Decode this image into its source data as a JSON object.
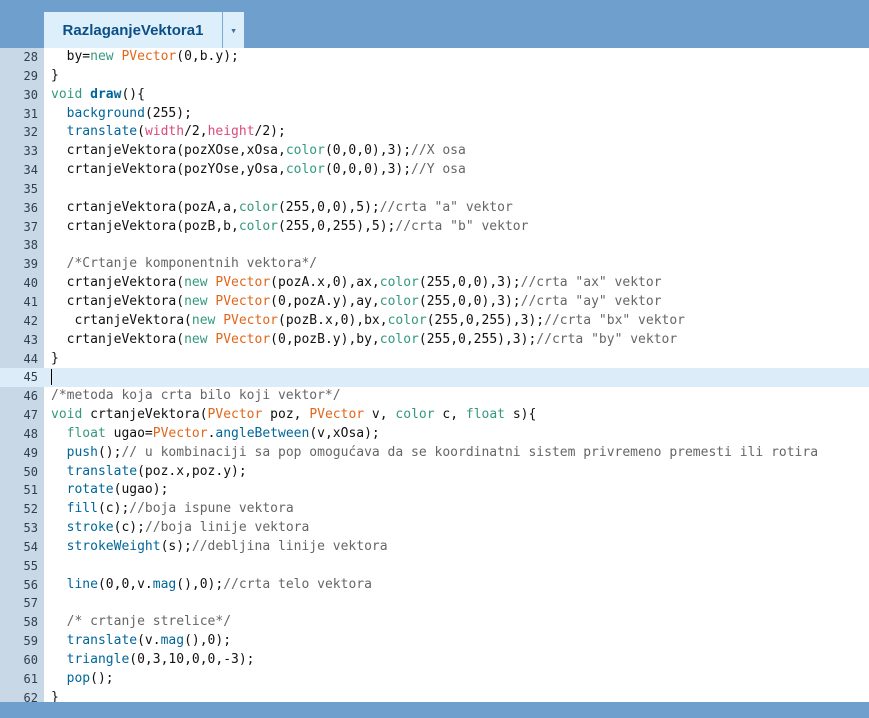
{
  "tab": {
    "title": "RazlaganjeVektora1",
    "menu_glyph": "▾"
  },
  "lines": [
    {
      "n": "28",
      "t": "  by=new PVector(0,b.y);"
    },
    {
      "n": "29",
      "t": "}"
    },
    {
      "n": "30",
      "t": "void draw(){"
    },
    {
      "n": "31",
      "t": "  background(255);"
    },
    {
      "n": "32",
      "t": "  translate(width/2,height/2);"
    },
    {
      "n": "33",
      "t": "  crtanjeVektora(pozXOse,xOsa,color(0,0,0),3);//X osa"
    },
    {
      "n": "34",
      "t": "  crtanjeVektora(pozYOse,yOsa,color(0,0,0),3);//Y osa"
    },
    {
      "n": "35",
      "t": ""
    },
    {
      "n": "36",
      "t": "  crtanjeVektora(pozA,a,color(255,0,0),5);//crta \"a\" vektor"
    },
    {
      "n": "37",
      "t": "  crtanjeVektora(pozB,b,color(255,0,255),5);//crta \"b\" vektor"
    },
    {
      "n": "38",
      "t": ""
    },
    {
      "n": "39",
      "t": "  /*Crtanje komponentnih vektora*/"
    },
    {
      "n": "40",
      "t": "  crtanjeVektora(new PVector(pozA.x,0),ax,color(255,0,0),3);//crta \"ax\" vektor"
    },
    {
      "n": "41",
      "t": "  crtanjeVektora(new PVector(0,pozA.y),ay,color(255,0,0),3);//crta \"ay\" vektor"
    },
    {
      "n": "42",
      "t": "   crtanjeVektora(new PVector(pozB.x,0),bx,color(255,0,255),3);//crta \"bx\" vektor"
    },
    {
      "n": "43",
      "t": "  crtanjeVektora(new PVector(0,pozB.y),by,color(255,0,255),3);//crta \"by\" vektor"
    },
    {
      "n": "44",
      "t": "}"
    },
    {
      "n": "45",
      "t": ""
    },
    {
      "n": "46",
      "t": "/*metoda koja crta bilo koji vektor*/"
    },
    {
      "n": "47",
      "t": "void crtanjeVektora(PVector poz, PVector v, color c, float s){"
    },
    {
      "n": "48",
      "t": "  float ugao=PVector.angleBetween(v,xOsa);"
    },
    {
      "n": "49",
      "t": "  push();// u kombinaciji sa pop omogućava da se koordinatni sistem privremeno premesti ili rotira"
    },
    {
      "n": "50",
      "t": "  translate(poz.x,poz.y);"
    },
    {
      "n": "51",
      "t": "  rotate(ugao);"
    },
    {
      "n": "52",
      "t": "  fill(c);//boja ispune vektora"
    },
    {
      "n": "53",
      "t": "  stroke(c);//boja linije vektora"
    },
    {
      "n": "54",
      "t": "  strokeWeight(s);//debljina linije vektora"
    },
    {
      "n": "55",
      "t": ""
    },
    {
      "n": "56",
      "t": "  line(0,0,v.mag(),0);//crta telo vektora"
    },
    {
      "n": "57",
      "t": ""
    },
    {
      "n": "58",
      "t": "  /* crtanje strelice*/"
    },
    {
      "n": "59",
      "t": "  translate(v.mag(),0);"
    },
    {
      "n": "60",
      "t": "  triangle(0,3,10,0,0,-3);"
    },
    {
      "n": "61",
      "t": "  pop();"
    },
    {
      "n": "62",
      "t": "}"
    }
  ],
  "current_line": "45",
  "colors": {
    "chrome": "#6f9fcc",
    "tab_bg": "#dceffb",
    "tab_text": "#0c4f86",
    "gutter": "#c8d8e6",
    "current_line": "#dcecf9",
    "keyword": "#33997e",
    "function": "#006699",
    "type_name": "#e2661a",
    "comment": "#666666",
    "constant": "#d94a7a"
  }
}
